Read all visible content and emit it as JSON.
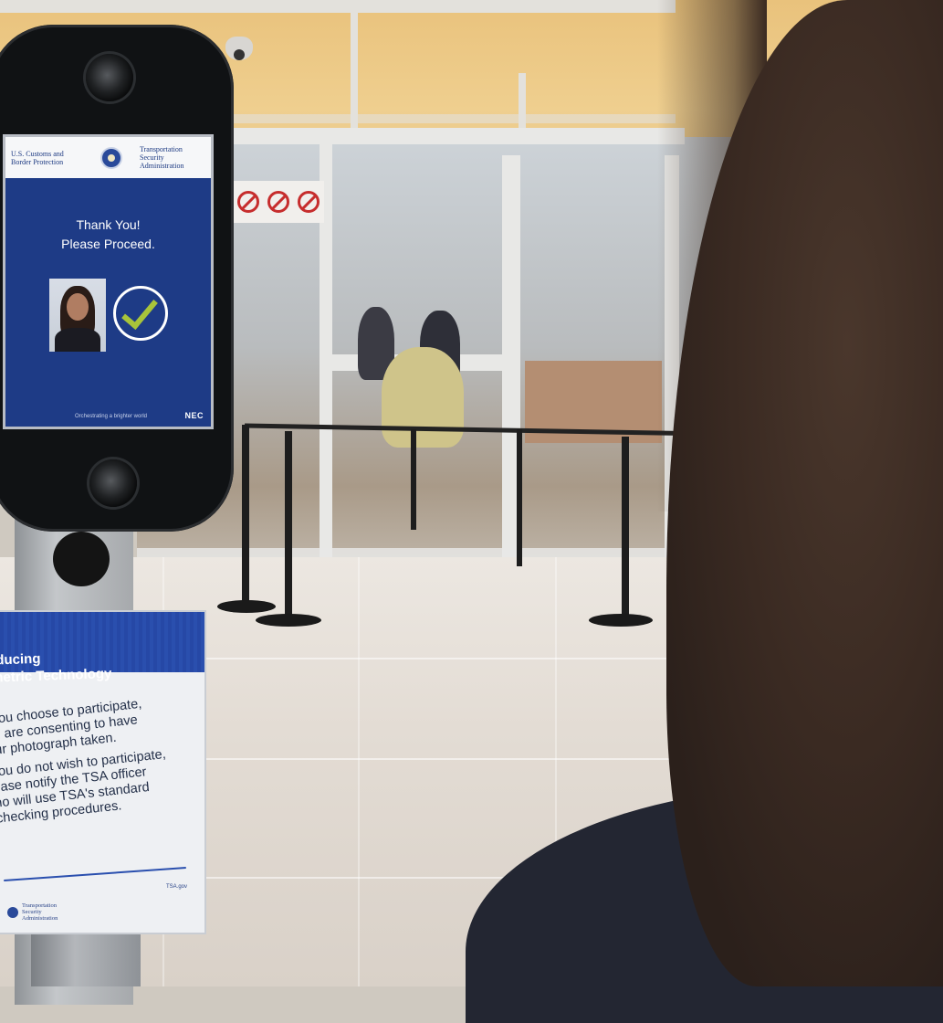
{
  "kiosk": {
    "agency_left": "U.S. Customs and Border Protection",
    "agency_right": "Transportation Security Administration",
    "message_line1": "Thank You!",
    "message_line2": "Please Proceed.",
    "footer_tagline": "Orchestrating a brighter world",
    "footer_brand": "NEC",
    "check_color": "#a8c43a",
    "screen_color": "#1e3b86"
  },
  "sign": {
    "title_line1": "roducing",
    "title_line2": "ometric Technology",
    "para1_line1": "you choose to participate,",
    "para1_line2": "u are consenting to have",
    "para1_line3": "ur photograph taken.",
    "para2_line1": "you do not wish to participate,",
    "para2_line2": "ease notify the TSA officer",
    "para2_line3": "ho will use TSA's standard",
    "para2_line4": "checking procedures.",
    "footer_org": "Transportation Security Administration",
    "footer_url": "TSA.gov",
    "band_color": "#2a4fae"
  }
}
